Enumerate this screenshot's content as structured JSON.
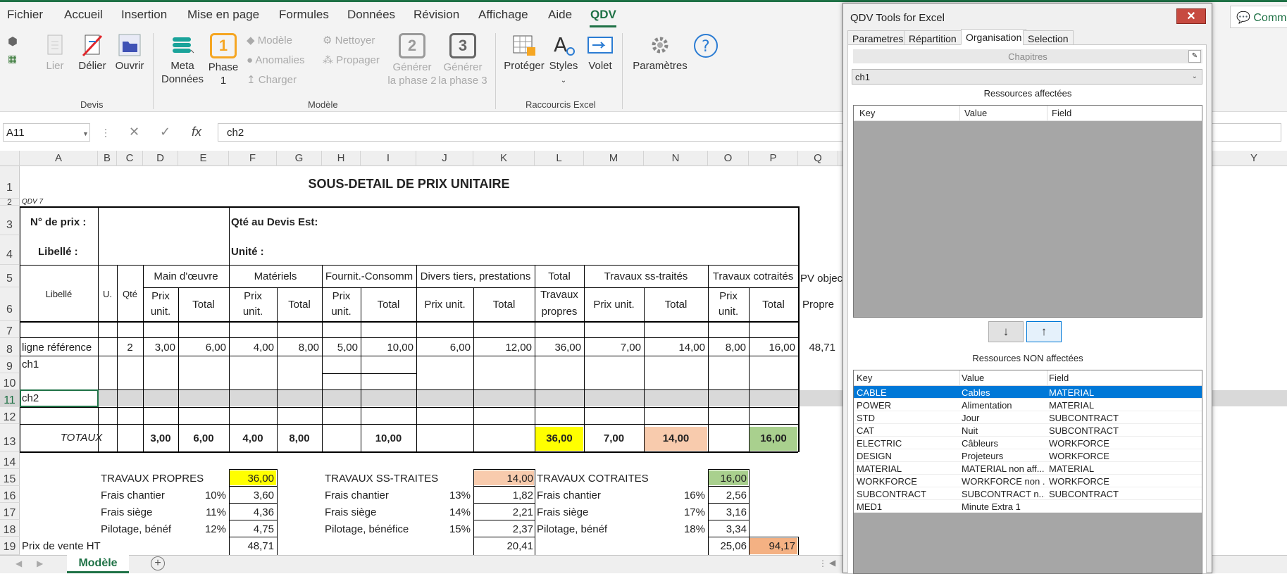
{
  "menu": {
    "items": [
      "Fichier",
      "Accueil",
      "Insertion",
      "Mise en page",
      "Formules",
      "Données",
      "Révision",
      "Affichage",
      "Aide",
      "QDV"
    ],
    "active": "QDV",
    "comment_button": "Comm"
  },
  "ribbon": {
    "lier": "Lier",
    "delier": "Délier",
    "ouvrir": "Ouvrir",
    "meta": "Meta",
    "donnees": "Données",
    "phase": "Phase",
    "phase_num": "1",
    "modele": "Modèle",
    "anomalies": "Anomalies",
    "charger": "Charger",
    "nettoyer": "Nettoyer",
    "propager": "Propager",
    "gen2_num": "2",
    "gen2_l1": "Générer",
    "gen2_l2": "la phase 2",
    "gen3_num": "3",
    "gen3_l1": "Générer",
    "gen3_l2": "la phase 3",
    "proteger": "Protéger",
    "styles": "Styles",
    "volet": "Volet",
    "parametres": "Paramètres",
    "group_devis": "Devis",
    "group_modele": "Modèle",
    "group_raccourcis": "Raccourcis Excel"
  },
  "formula_bar": {
    "namebox": "A11",
    "content": "ch2"
  },
  "columns": [
    "A",
    "B",
    "C",
    "D",
    "E",
    "F",
    "G",
    "H",
    "I",
    "J",
    "K",
    "L",
    "M",
    "N",
    "O",
    "P",
    "Q",
    "Y"
  ],
  "rows": [
    "1",
    "2",
    "3",
    "4",
    "5",
    "6",
    "7",
    "8",
    "9",
    "10",
    "11",
    "12",
    "13",
    "14",
    "15",
    "16",
    "17",
    "18",
    "19"
  ],
  "sheet": {
    "title": "SOUS-DETAIL DE PRIX UNITAIRE",
    "qdv": "QDV 7",
    "n_prix": "N° de prix :",
    "qte_devis": "Qté au Devis Est:",
    "libelle_lbl": "Libellé :",
    "unite": "Unité :",
    "main_oeuvre": "Main d'œuvre",
    "materiels": "Matériels",
    "fournit": "Fournit.-Consomm",
    "divers": "Divers tiers, prestations",
    "total": "Total",
    "travaux": "Travaux",
    "propres": "propres",
    "ss_traites": "Travaux ss-traités",
    "cotraites": "Travaux cotraités",
    "pv_obj": "PV objec",
    "libelle_col": "Libellé",
    "u": "U.",
    "qte": "Qté",
    "prix": "Prix",
    "unit": "unit.",
    "total_col": "Total",
    "prix_unit": "Prix unit.",
    "propre": "Propre",
    "row8": [
      "ligne référence",
      "2",
      "3,00",
      "6,00",
      "4,00",
      "8,00",
      "5,00",
      "10,00",
      "6,00",
      "12,00",
      "36,00",
      "7,00",
      "14,00",
      "8,00",
      "16,00",
      "48,71"
    ],
    "row9": "ch1",
    "row11": "ch2",
    "totaux_label": "TOTAUX",
    "totaux": [
      "3,00",
      "6,00",
      "4,00",
      "8,00",
      "10,00",
      "36,00",
      "7,00",
      "14,00",
      "16,00"
    ],
    "travaux_propres": "TRAVAUX PROPRES",
    "travaux_propres_val": "36,00",
    "frais_chantier": "Frais chantier",
    "frais_siege": "Frais siège",
    "pilotage1": "Pilotage, bénéf",
    "pilotage2": "Pilotage, bénéfice",
    "tp_pct": [
      "10%",
      "11%",
      "12%"
    ],
    "tp_val": [
      "3,60",
      "4,36",
      "4,75"
    ],
    "travaux_ss": "TRAVAUX SS-TRAITES",
    "travaux_ss_val": "14,00",
    "ts_pct": [
      "13%",
      "14%",
      "15%"
    ],
    "ts_val": [
      "1,82",
      "2,21",
      "2,37"
    ],
    "travaux_cot": "TRAVAUX COTRAITES",
    "travaux_cot_val": "16,00",
    "tc_pct": [
      "16%",
      "17%",
      "18%"
    ],
    "tc_val": [
      "2,56",
      "3,16",
      "3,34"
    ],
    "prix_vente": "Prix de vente HT",
    "pv_vals": [
      "48,71",
      "20,41",
      "25,06",
      "94,17"
    ]
  },
  "sheet_tab": "Modèle",
  "panel": {
    "title": "QDV Tools for Excel",
    "close": "✕",
    "tabs": [
      "Parametres",
      "Répartition",
      "Organisation",
      "Selection"
    ],
    "active_tab": "Organisation",
    "chapitres": "Chapitres",
    "chapitre_value": "ch1",
    "affectees": "Ressources affectées",
    "non_affectees": "Ressources NON affectées",
    "headers": [
      "Key",
      "Value",
      "Field"
    ],
    "down": "↓",
    "up": "↑",
    "resources": [
      {
        "key": "CABLE",
        "value": "Cables",
        "field": "MATERIAL"
      },
      {
        "key": "POWER",
        "value": "Alimentation",
        "field": "MATERIAL"
      },
      {
        "key": "STD",
        "value": "Jour",
        "field": "SUBCONTRACT"
      },
      {
        "key": "CAT",
        "value": "Nuit",
        "field": "SUBCONTRACT"
      },
      {
        "key": "ELECTRIC",
        "value": "Câbleurs",
        "field": "WORKFORCE"
      },
      {
        "key": "DESIGN",
        "value": "Projeteurs",
        "field": "WORKFORCE"
      },
      {
        "key": "MATERIAL",
        "value": "MATERIAL non aff...",
        "field": "MATERIAL"
      },
      {
        "key": "WORKFORCE",
        "value": "WORKFORCE non ...",
        "field": "WORKFORCE"
      },
      {
        "key": "SUBCONTRACT",
        "value": "SUBCONTRACT n...",
        "field": "SUBCONTRACT"
      },
      {
        "key": "MED1",
        "value": "Minute Extra 1",
        "field": ""
      }
    ]
  },
  "colors": {
    "accent": "#1e7145",
    "yellow": "#ffff00",
    "peach": "#f8cbad",
    "green": "#a9d08e",
    "orange": "#f4b183",
    "selected": "#0078d7"
  }
}
